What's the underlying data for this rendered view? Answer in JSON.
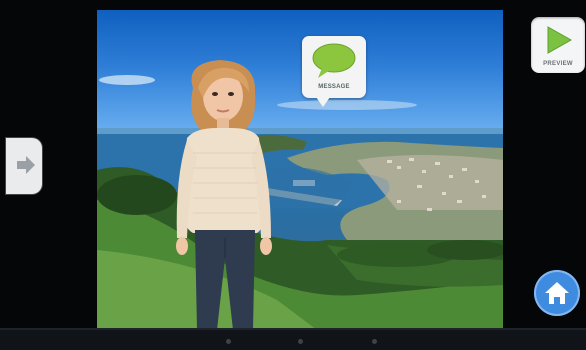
{
  "toolbar": {
    "preview_label": "PREVIEW",
    "message_label": "MESSAGE"
  },
  "icons": {
    "side_toggle": "arrow-right-icon",
    "preview": "play-icon",
    "message": "speech-bubble-icon",
    "home": "home-icon"
  },
  "colors": {
    "preview_green": "#7bc142",
    "message_green": "#8cc63f",
    "home_blue": "#3f8be0",
    "background": "#050607"
  }
}
